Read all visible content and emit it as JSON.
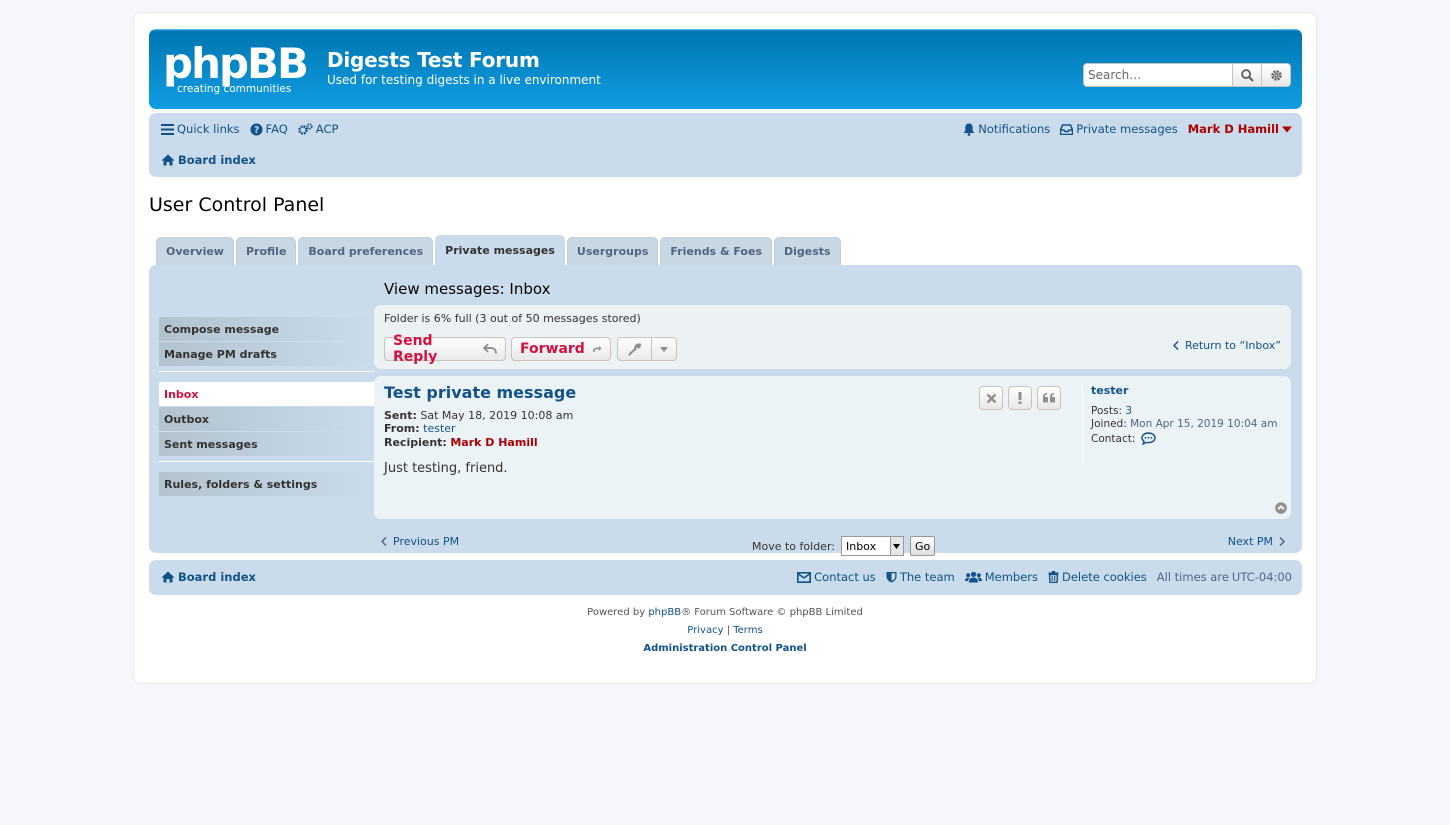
{
  "site": {
    "logo_text": "phpBB",
    "logo_sub": "creating communities",
    "title": "Digests Test Forum",
    "description": "Used for testing digests in a live environment"
  },
  "search": {
    "placeholder": "Search…"
  },
  "nav": {
    "quick_links": "Quick links",
    "faq": "FAQ",
    "acp": "ACP",
    "notifications": "Notifications",
    "private_messages": "Private messages",
    "user": "Mark D Hamill",
    "board_index": "Board index"
  },
  "page_title": "User Control Panel",
  "tabs": [
    "Overview",
    "Profile",
    "Board preferences",
    "Private messages",
    "Usergroups",
    "Friends & Foes",
    "Digests"
  ],
  "sidebar": {
    "compose": "Compose message",
    "drafts": "Manage PM drafts",
    "inbox": "Inbox",
    "outbox": "Outbox",
    "sent": "Sent messages",
    "rules": "Rules, folders & settings"
  },
  "view_title": "View messages: Inbox",
  "folder_info": "Folder is 6% full (3 out of 50 messages stored)",
  "buttons": {
    "send_reply": "Send Reply",
    "forward": "Forward"
  },
  "return_link": "Return to “Inbox”",
  "message": {
    "title": "Test private message",
    "sent_label": "Sent:",
    "sent_value": "Sat May 18, 2019 10:08 am",
    "from_label": "From:",
    "from_value": "tester",
    "recipient_label": "Recipient:",
    "recipient_value": "Mark D Hamill",
    "content": "Just testing, friend."
  },
  "profile": {
    "name": "tester",
    "posts_label": "Posts:",
    "posts_value": "3",
    "joined_label": "Joined:",
    "joined_value": "Mon Apr 15, 2019 10:04 am",
    "contact_label": "Contact:"
  },
  "pm_nav": {
    "previous": "Previous PM",
    "next": "Next PM",
    "move_label": "Move to folder:",
    "folder_selected": "Inbox",
    "go": "Go"
  },
  "footer": {
    "board_index": "Board index",
    "contact": "Contact us",
    "team": "The team",
    "members": "Members",
    "delete_cookies": "Delete cookies",
    "times_label": "All times are",
    "timezone": "UTC-04:00"
  },
  "copyright": {
    "powered_prefix": "Powered by",
    "phpbb": "phpBB",
    "powered_suffix": "® Forum Software © phpBB Limited",
    "privacy": "Privacy",
    "sep": "|",
    "terms": "Terms",
    "acp": "Administration Control Panel"
  },
  "colors": {
    "accent": "#105289",
    "header": "#12A3EB",
    "red": "#d31141",
    "user": "#AA0000",
    "panel": "#cadceb"
  }
}
